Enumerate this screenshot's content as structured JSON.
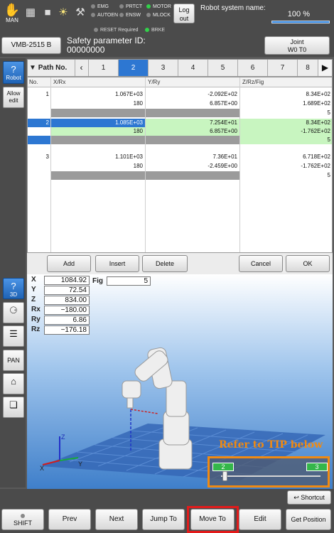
{
  "topbar": {
    "mode_label": "MAN",
    "indicators": [
      {
        "label": "EMG",
        "on": false
      },
      {
        "label": "PRTCT",
        "on": false
      },
      {
        "label": "MOTOR",
        "on": true
      },
      {
        "label": "AUTOEN",
        "on": false
      },
      {
        "label": "ENSW",
        "on": false
      },
      {
        "label": "MLOCK",
        "on": false
      }
    ],
    "status_row": [
      {
        "label": "RESET Required",
        "on": false
      },
      {
        "label": "BRKE",
        "on": true
      }
    ],
    "logout_line1": "Log",
    "logout_line2": "out",
    "robot_system_name_label": "Robot system name:",
    "speed_text": "100 %",
    "speed_fraction": 1.0
  },
  "header": {
    "robot_model": "VMB-2515 B",
    "safety_param_label": "Safety parameter ID:",
    "safety_param_value": "00000000",
    "joint_line1": "Joint",
    "joint_line2": "W0 T0"
  },
  "sidebar": {
    "robot": "Robot",
    "allow_edit_1": "Allow",
    "allow_edit_2": "edit",
    "view3d": "3D",
    "pan": "PAN"
  },
  "path_tabs": {
    "label": "Path No.",
    "tabs": [
      "1",
      "2",
      "3",
      "4",
      "5",
      "6",
      "7",
      "8"
    ],
    "active": "2"
  },
  "table": {
    "headers": [
      "No.",
      "X/Rx",
      "Y/Ry",
      "Z/Rz/Fig"
    ],
    "rows": [
      {
        "no": "1",
        "c1": "1.067E+03",
        "c2": "-2.092E+02",
        "c3": "8.34E+02"
      },
      {
        "no": "",
        "c1": "180",
        "c2": "6.857E+00",
        "c3": "1.689E+02"
      },
      {
        "no": "",
        "c1": "",
        "c2": "",
        "c3": "5"
      },
      {
        "no": "2",
        "c1": "1.085E+03",
        "c2": "7.254E+01",
        "c3": "8.34E+02"
      },
      {
        "no": "",
        "c1": "180",
        "c2": "6.857E+00",
        "c3": "-1.762E+02"
      },
      {
        "no": "",
        "c1": "",
        "c2": "",
        "c3": "5"
      },
      {
        "no": "3",
        "c1": "1.101E+03",
        "c2": "7.36E+01",
        "c3": "6.718E+02"
      },
      {
        "no": "",
        "c1": "180",
        "c2": "-2.459E+00",
        "c3": "-1.762E+02"
      },
      {
        "no": "",
        "c1": "",
        "c2": "",
        "c3": "5"
      }
    ]
  },
  "actions": {
    "add": "Add",
    "insert": "Insert",
    "delete": "Delete",
    "cancel": "Cancel",
    "ok": "OK"
  },
  "position": {
    "X": "1084.92",
    "Y": "72.54",
    "Z": "834.00",
    "Rx": "−180.00",
    "Ry": "6.86",
    "Rz": "−176.18",
    "fig_label": "Fig",
    "fig_value": "5"
  },
  "viewer": {
    "tip_text": "Refer to TIP below",
    "range_start": "2",
    "range_end": "3",
    "slider_fraction": 0.0
  },
  "bottom": {
    "shortcut": "Shortcut",
    "shift": "SHIFT",
    "prev": "Prev",
    "next": "Next",
    "jump_to": "Jump To",
    "move_to": "Move To",
    "edit": "Edit",
    "get_position": "Get Position"
  },
  "colors": {
    "accent_blue": "#2d77d2",
    "highlight_red": "#e21b1b",
    "tip_orange": "#f08a12",
    "led_green": "#32d24a",
    "row_selected_green": "#c8f5c0"
  }
}
